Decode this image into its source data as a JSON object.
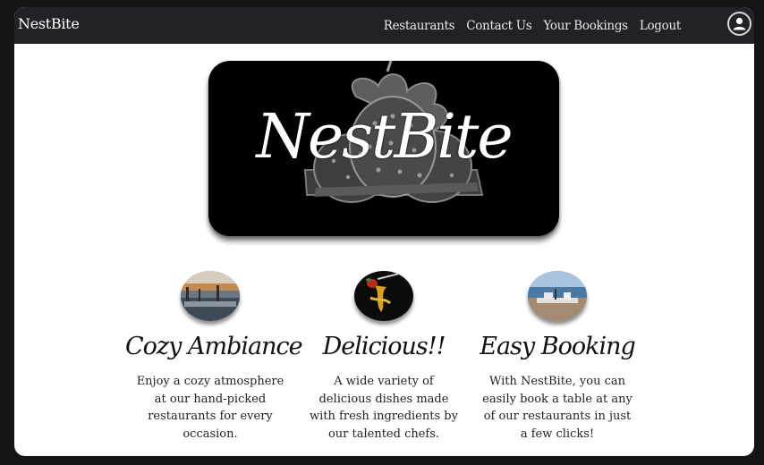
{
  "navbar": {
    "brand": "NestBite",
    "links": [
      "Restaurants",
      "Contact Us",
      "Your Bookings",
      "Logout"
    ],
    "avatar_icon": "user-circle-icon"
  },
  "hero": {
    "logo_text": "NestBite"
  },
  "features": [
    {
      "title": "Cozy Ambiance",
      "text": "Enjoy a cozy atmosphere at our hand-picked restaurants for every occasion.",
      "image": "harbor-restaurant-photo"
    },
    {
      "title": "Delicious!!",
      "text": "A wide variety of delicious dishes made with fresh ingredients by our talented chefs.",
      "image": "pasta-fork-photo"
    },
    {
      "title": "Easy Booking",
      "text": "With NestBite, you can easily book a table at any of our restaurants in just a few clicks!",
      "image": "seaside-table-photo"
    }
  ],
  "colors": {
    "page_bg": "#131416",
    "navbar_bg": "#202225",
    "content_bg": "#ffffff",
    "hero_bg": "#000000"
  }
}
